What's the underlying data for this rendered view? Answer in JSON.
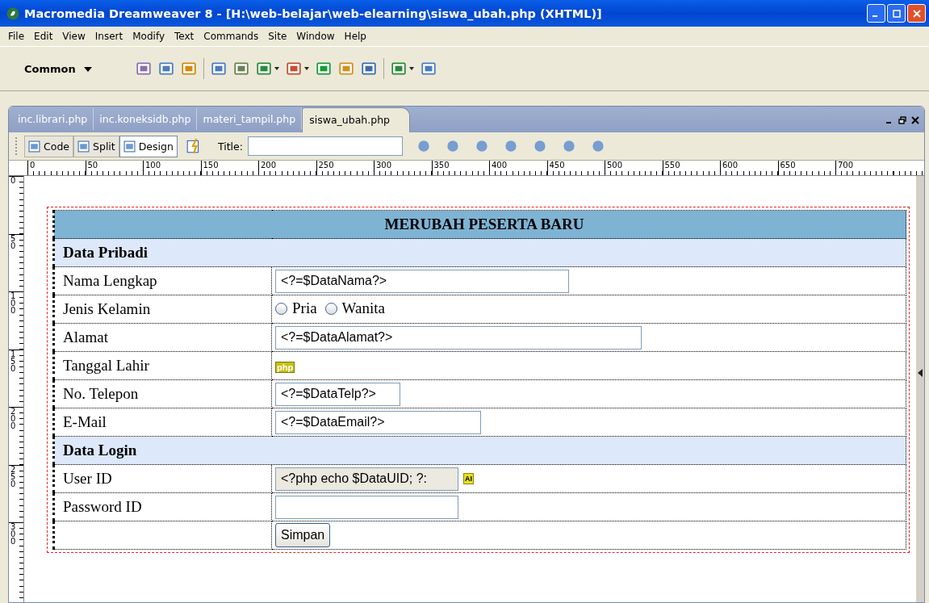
{
  "window": {
    "title": "Macromedia Dreamweaver 8 - [H:\\web-belajar\\web-elearning\\siswa_ubah.php (XHTML)]"
  },
  "menu": [
    "File",
    "Edit",
    "View",
    "Insert",
    "Modify",
    "Text",
    "Commands",
    "Site",
    "Window",
    "Help"
  ],
  "insert_bar": {
    "category": "Common"
  },
  "document_tabs": [
    {
      "label": "inc.librari.php",
      "selected": false
    },
    {
      "label": "inc.koneksidb.php",
      "selected": false
    },
    {
      "label": "materi_tampil.php",
      "selected": false
    },
    {
      "label": "siswa_ubah.php",
      "selected": true
    }
  ],
  "view_buttons": [
    {
      "label": "Code",
      "selected": false
    },
    {
      "label": "Split",
      "selected": false
    },
    {
      "label": "Design",
      "selected": true
    }
  ],
  "title_field": {
    "label": "Title:"
  },
  "ruler": {
    "horizontal": [
      "0",
      "50",
      "100",
      "150",
      "200",
      "250",
      "300",
      "350",
      "400",
      "450",
      "500",
      "550",
      "600",
      "650",
      "700"
    ],
    "vertical": [
      "0",
      "50",
      "100",
      "150",
      "200",
      "250",
      "300"
    ]
  },
  "form": {
    "heading": "MERUBAH PESERTA BARU",
    "rows": [
      {
        "kind": "section",
        "label": "Data Pribadi"
      },
      {
        "kind": "field",
        "label": "Nama Lengkap",
        "value": "<?=$DataNama?>",
        "disabled": false
      },
      {
        "kind": "radio",
        "label": "Jenis Kelamin",
        "options": [
          {
            "label": "Pria",
            "selected": false
          },
          {
            "label": "Wanita",
            "selected": false
          }
        ]
      },
      {
        "kind": "field",
        "label": "Alamat",
        "value": "<?=$DataAlamat?>",
        "disabled": false
      },
      {
        "kind": "php",
        "label": "Tanggal Lahir",
        "marker": "php"
      },
      {
        "kind": "field",
        "label": "No. Telepon",
        "value": "<?=$DataTelp?>",
        "disabled": false
      },
      {
        "kind": "field",
        "label": "E-Mail",
        "value": "<?=$DataEmail?>",
        "disabled": false
      },
      {
        "kind": "section",
        "label": "Data Login"
      },
      {
        "kind": "field",
        "label": "User ID",
        "value": "<?php echo $DataUID; ?:",
        "disabled": true,
        "marker": "AI"
      },
      {
        "kind": "field",
        "label": "Password ID",
        "disabled": false
      },
      {
        "kind": "button",
        "label": "Simpan"
      }
    ]
  }
}
